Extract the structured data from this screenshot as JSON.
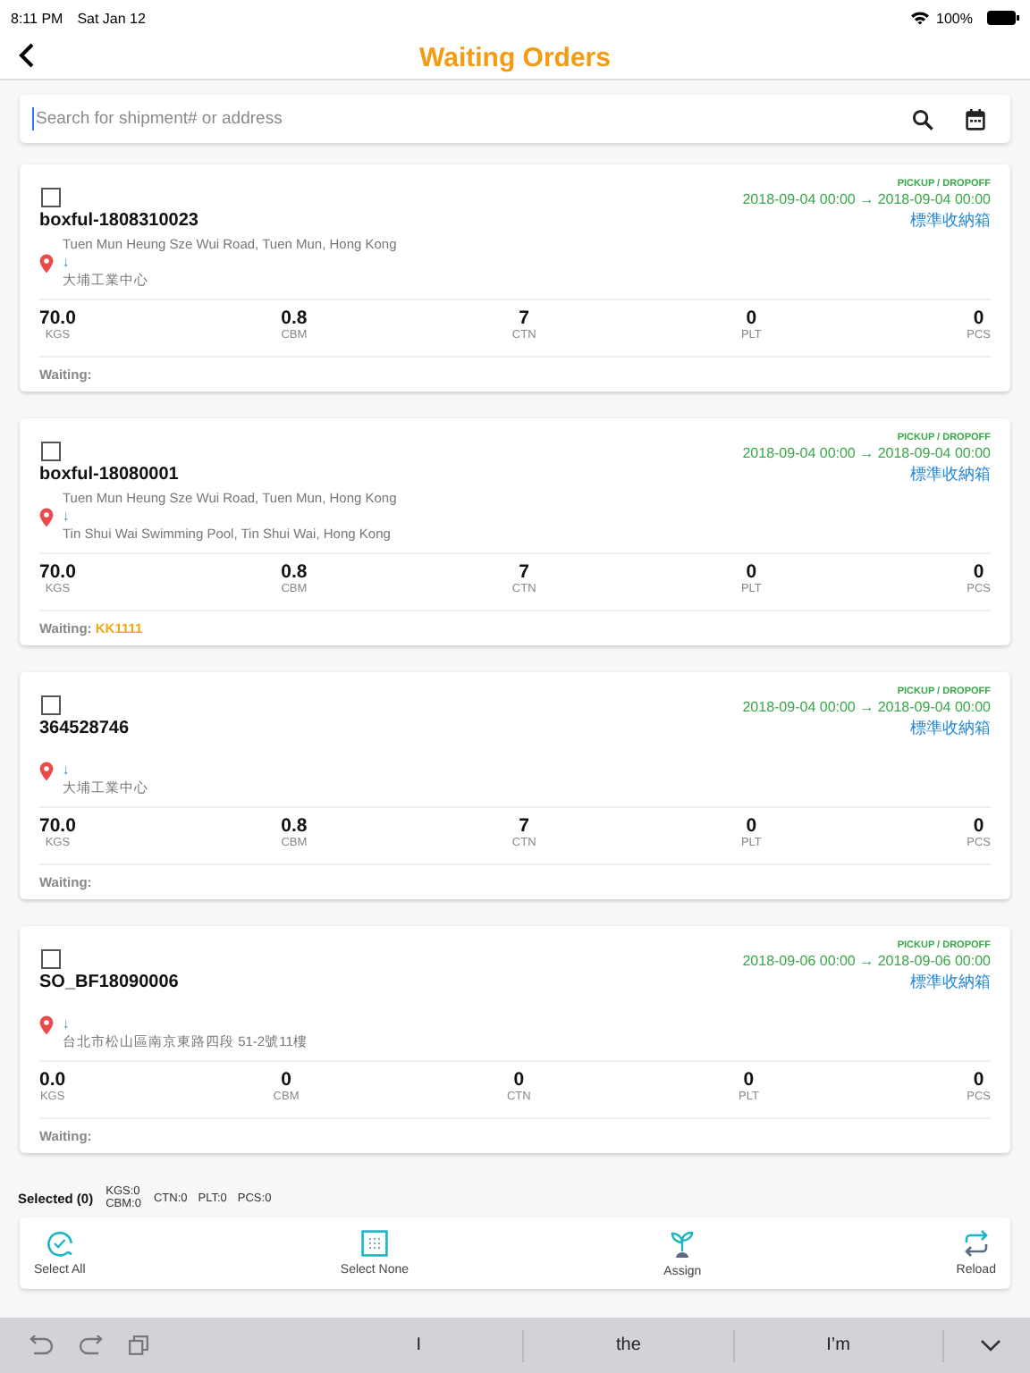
{
  "status_bar": {
    "time": "8:11 PM",
    "date": "Sat Jan 12",
    "battery": "100%"
  },
  "nav": {
    "title": "Waiting Orders"
  },
  "search": {
    "placeholder": "Search for shipment# or address"
  },
  "orders": [
    {
      "checked": false,
      "schedule_label": "PICKUP / DROPOFF",
      "dates": "2018-09-04 00:00 → 2018-09-04 00:00",
      "id": "boxful-1808310023",
      "service": "標準收納箱",
      "from": "Tuen Mun Heung Sze Wui Road, Tuen Mun, Hong Kong",
      "arrow": "↓",
      "to": "大埔工業中心",
      "stats": [
        {
          "value": "70.0",
          "unit": "KGS"
        },
        {
          "value": "0.8",
          "unit": "CBM"
        },
        {
          "value": "7",
          "unit": "CTN"
        },
        {
          "value": "0",
          "unit": "PLT"
        },
        {
          "value": "0",
          "unit": "PCS"
        }
      ],
      "waiting_label": "Waiting:"
    },
    {
      "checked": false,
      "schedule_label": "PICKUP / DROPOFF",
      "dates": "2018-09-04 00:00 → 2018-09-04 00:00",
      "id": "boxful-18080001",
      "service": "標準收納箱",
      "from": "Tuen Mun Heung Sze Wui Road, Tuen Mun, Hong Kong",
      "arrow": "↓",
      "to": "Tin Shui Wai Swimming Pool, Tin Shui Wai, Hong Kong",
      "stats": [
        {
          "value": "70.0",
          "unit": "KGS"
        },
        {
          "value": "0.8",
          "unit": "CBM"
        },
        {
          "value": "7",
          "unit": "CTN"
        },
        {
          "value": "0",
          "unit": "PLT"
        },
        {
          "value": "0",
          "unit": "PCS"
        }
      ],
      "waiting_label": "Waiting:",
      "waiting_value": "KK1111"
    },
    {
      "checked": false,
      "schedule_label": "PICKUP / DROPOFF",
      "dates": "2018-09-04 00:00 → 2018-09-04 00:00",
      "id": "364528746",
      "service": "標準收納箱",
      "arrow": "↓",
      "to": "大埔工業中心",
      "stats": [
        {
          "value": "70.0",
          "unit": "KGS"
        },
        {
          "value": "0.8",
          "unit": "CBM"
        },
        {
          "value": "7",
          "unit": "CTN"
        },
        {
          "value": "0",
          "unit": "PLT"
        },
        {
          "value": "0",
          "unit": "PCS"
        }
      ],
      "waiting_label": "Waiting:"
    },
    {
      "checked": false,
      "schedule_label": "PICKUP / DROPOFF",
      "dates": "2018-09-06 00:00 → 2018-09-06 00:00",
      "id": "SO_BF18090006",
      "service": "標準收納箱",
      "arrow": "↓",
      "to": "台北市松山區南京東路四段 51-2號11樓",
      "stats": [
        {
          "value": "0.0",
          "unit": "KGS"
        },
        {
          "value": "0",
          "unit": "CBM"
        },
        {
          "value": "0",
          "unit": "CTN"
        },
        {
          "value": "0",
          "unit": "PLT"
        },
        {
          "value": "0",
          "unit": "PCS"
        }
      ],
      "waiting_label": "Waiting:"
    }
  ],
  "summary": {
    "selected": "Selected (0)",
    "kgs": "KGS:0",
    "cbm": "CBM:0",
    "ctn": "CTN:0",
    "plt": "PLT:0",
    "pcs": "PCS:0"
  },
  "actions": [
    {
      "kind": "select_all",
      "label": "Select All"
    },
    {
      "kind": "select_none",
      "label": "Select None"
    },
    {
      "kind": "assign",
      "label": "Assign"
    },
    {
      "kind": "reload",
      "label": "Reload"
    }
  ],
  "keyboard": {
    "suggestions": [
      "I",
      "the",
      "I’m"
    ]
  }
}
